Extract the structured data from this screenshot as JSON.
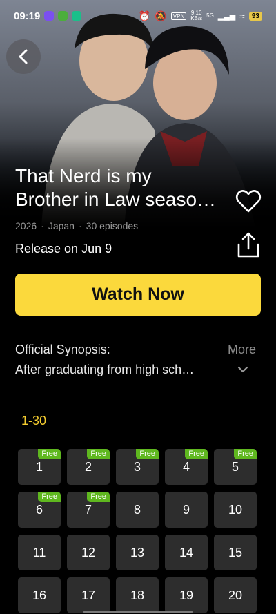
{
  "status_bar": {
    "time": "09:19",
    "net_speed": "9.10",
    "net_unit": "KB/s",
    "signal": "5G",
    "vpn": "VPN",
    "battery": "93"
  },
  "show": {
    "title_line1": "That Nerd is my",
    "title_line2": "Brother in Law seaso…",
    "year": "2026",
    "country": "Japan",
    "episodes": "30 episodes",
    "meta_sep": "·",
    "release": "Release on Jun 9"
  },
  "actions": {
    "watch_now": "Watch Now"
  },
  "synopsis": {
    "label": "Official Synopsis:",
    "more": "More",
    "text": "After graduating from high sch…"
  },
  "episode_range": "1-30",
  "free_label": "Free",
  "episodes": [
    {
      "num": "1",
      "free": true
    },
    {
      "num": "2",
      "free": true
    },
    {
      "num": "3",
      "free": true
    },
    {
      "num": "4",
      "free": true
    },
    {
      "num": "5",
      "free": true
    },
    {
      "num": "6",
      "free": true
    },
    {
      "num": "7",
      "free": true
    },
    {
      "num": "8",
      "free": false
    },
    {
      "num": "9",
      "free": false
    },
    {
      "num": "10",
      "free": false
    },
    {
      "num": "11",
      "free": false
    },
    {
      "num": "12",
      "free": false
    },
    {
      "num": "13",
      "free": false
    },
    {
      "num": "14",
      "free": false
    },
    {
      "num": "15",
      "free": false
    },
    {
      "num": "16",
      "free": false
    },
    {
      "num": "17",
      "free": false
    },
    {
      "num": "18",
      "free": false
    },
    {
      "num": "19",
      "free": false
    },
    {
      "num": "20",
      "free": false
    }
  ],
  "colors": {
    "accent_yellow": "#fbd93c",
    "range_tab": "#f4cc2f",
    "free_badge": "#5fb81f",
    "cell_bg": "#2d2d2d"
  }
}
